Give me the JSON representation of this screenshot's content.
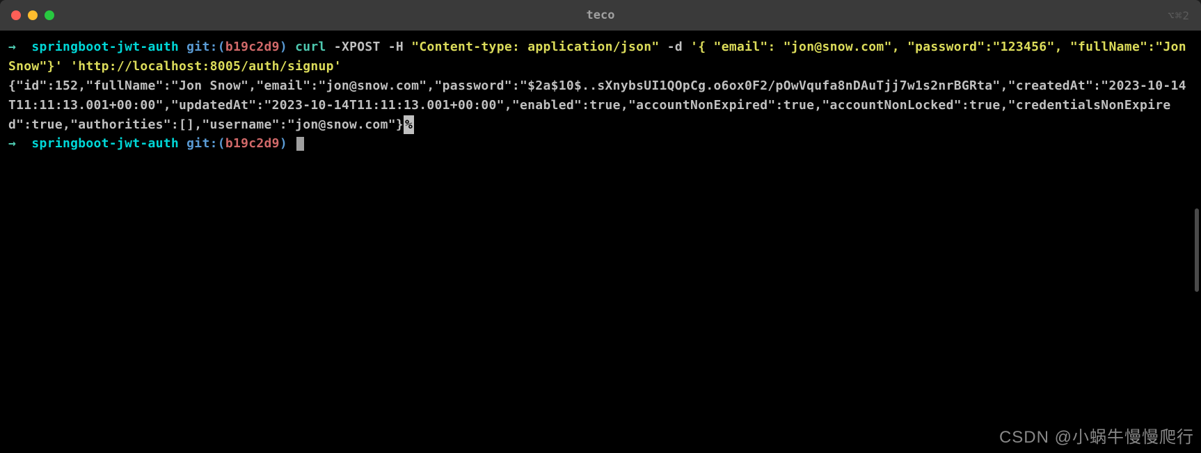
{
  "window": {
    "title": "teco",
    "tabIndicator": "⌥⌘2"
  },
  "prompt1": {
    "arrow": "→",
    "directory": "springboot-jwt-auth",
    "gitLabel": "git:(",
    "branch": "b19c2d9",
    "gitClose": ")",
    "command": {
      "executable": "curl",
      "part1": " -XPOST -H ",
      "header": "\"Content-type: application/json\"",
      "part2": " -d ",
      "body": "'{ \"email\": \"jon@snow.com\", \"password\":\"123456\", \"fullName\":\"Jon Snow\"}'",
      "url": "'http://localhost:8005/auth/signup'"
    }
  },
  "response": "{\"id\":152,\"fullName\":\"Jon Snow\",\"email\":\"jon@snow.com\",\"password\":\"$2a$10$..sXnybsUI1QOpCg.o6ox0F2/pOwVqufa8nDAuTjj7w1s2nrBGRta\",\"createdAt\":\"2023-10-14T11:11:13.001+00:00\",\"updatedAt\":\"2023-10-14T11:11:13.001+00:00\",\"enabled\":true,\"accountNonExpired\":true,\"accountNonLocked\":true,\"credentialsNonExpired\":true,\"authorities\":[],\"username\":\"jon@snow.com\"}",
  "responseEnd": "%",
  "prompt2": {
    "arrow": "→",
    "directory": "springboot-jwt-auth",
    "gitLabel": "git:(",
    "branch": "b19c2d9",
    "gitClose": ")"
  },
  "watermark": "CSDN @小蜗牛慢慢爬行"
}
